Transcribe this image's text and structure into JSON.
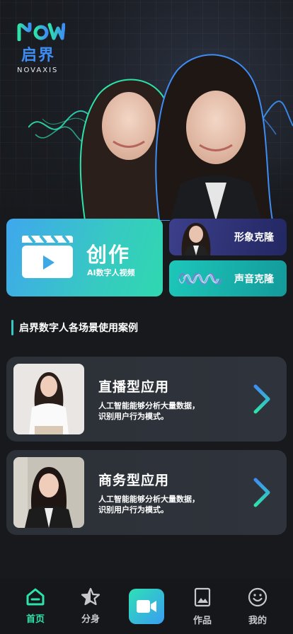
{
  "brand": {
    "name_cn": "启界",
    "name_en": "NOVAXIS",
    "logo_letters": "NOVA",
    "accent": "#2de3a8",
    "accent_blue": "#3e8df5"
  },
  "features": {
    "create": {
      "title": "创作",
      "subtitle": "AI数字人视频"
    },
    "avatar_clone": {
      "label": "形象克隆"
    },
    "voice_clone": {
      "label": "声音克隆"
    }
  },
  "section": {
    "title": "启界数字人各场景使用案例"
  },
  "cases": [
    {
      "title": "直播型应用",
      "desc_line1": "人工智能能够分析大量数据，",
      "desc_line2": "识别用户行为模式。"
    },
    {
      "title": "商务型应用",
      "desc_line1": "人工智能能够分析大量数据，",
      "desc_line2": "识别用户行为模式。"
    }
  ],
  "tabbar": {
    "home": "首页",
    "clone": "分身",
    "works": "作品",
    "mine": "我的"
  },
  "icons": [
    "home-icon",
    "star-icon",
    "video-camera-icon",
    "image-icon",
    "smile-icon",
    "chevron-right-icon",
    "clapperboard-icon"
  ]
}
